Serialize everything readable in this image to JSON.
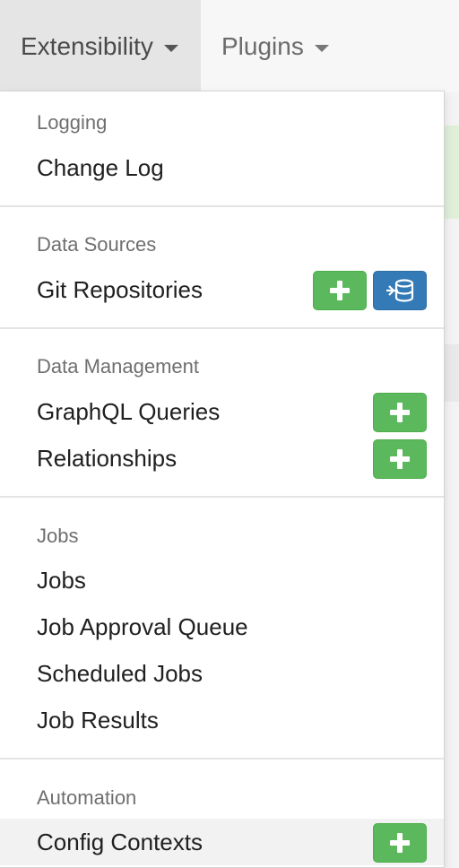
{
  "navbar": {
    "tabs": [
      {
        "label": "Extensibility",
        "active": true,
        "icon": "caret-down-icon"
      },
      {
        "label": "Plugins",
        "active": false,
        "icon": "caret-down-icon"
      }
    ]
  },
  "dropdown": {
    "sections": [
      {
        "header": "Logging",
        "items": [
          {
            "label": "Change Log"
          }
        ]
      },
      {
        "header": "Data Sources",
        "items": [
          {
            "label": "Git Repositories",
            "buttons": [
              "add-icon",
              "database-sync-icon"
            ]
          }
        ]
      },
      {
        "header": "Data Management",
        "items": [
          {
            "label": "GraphQL Queries",
            "buttons": [
              "add-icon"
            ]
          },
          {
            "label": "Relationships",
            "buttons": [
              "add-icon"
            ]
          }
        ]
      },
      {
        "header": "Jobs",
        "items": [
          {
            "label": "Jobs"
          },
          {
            "label": "Job Approval Queue"
          },
          {
            "label": "Scheduled Jobs"
          },
          {
            "label": "Job Results"
          }
        ]
      },
      {
        "header": "Automation",
        "items": [
          {
            "label": "Config Contexts",
            "buttons": [
              "add-icon"
            ],
            "hovered": true
          }
        ]
      }
    ]
  },
  "colors": {
    "success": "#5cb85c",
    "primary": "#337ab7",
    "header_text": "#6f6f6f",
    "item_text": "#202020",
    "active_tab_bg": "#e5e5e5"
  }
}
